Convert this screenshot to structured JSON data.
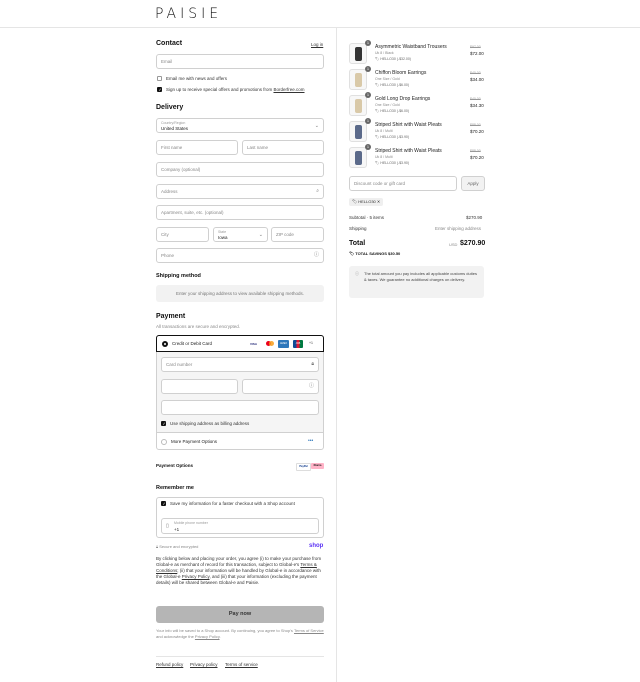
{
  "brand": "PAISIE",
  "contact": {
    "title": "Contact",
    "login_label": "Log in",
    "email_placeholder": "Email",
    "email_news_label": "Email me with news and offers",
    "sms_label_prefix": "Sign up to receive special offers and promotions from ",
    "sms_label_link": "Borderfree.com"
  },
  "delivery": {
    "title": "Delivery",
    "country_label": "Country/Region",
    "country_value": "United States",
    "first_name": "First name",
    "last_name": "Last name",
    "company": "Company (optional)",
    "address": "Address",
    "apartment": "Apartment, suite, etc. (optional)",
    "city": "City",
    "state_label": "State",
    "state_value": "Iowa",
    "zip": "ZIP code",
    "phone": "Phone"
  },
  "shipping": {
    "title": "Shipping method",
    "message": "Enter your shipping address to view available shipping methods."
  },
  "payment": {
    "title": "Payment",
    "subtitle": "All transactions are secure and encrypted.",
    "card_option": "Credit or Debit Card",
    "card_brands": [
      "VISA",
      "MC",
      "AMEX",
      "JCB",
      "+1"
    ],
    "card_number": "Card number",
    "billing_label": "Use shipping address as billing address",
    "more_options": "More Payment Options",
    "options_label": "Payment Options",
    "wallets": [
      "PayPal",
      "Klarna"
    ]
  },
  "remember": {
    "title": "Remember me",
    "save_label": "Save my information for a faster checkout with a Shop account",
    "mobile_label": "Mobile phone number",
    "mobile_value": "+1",
    "secure_label": "Secure and encrypted",
    "shop_label": "shop"
  },
  "legal": {
    "p1": "By clicking below and placing your order, you agree (i) to make your purchase from Global-e as merchant of record for this transaction, subject to Global-e's",
    "terms": "Terms & Conditions",
    "p2": "; (ii) that your information will be handled by Global-e in accordance with the Global-e",
    "privacy": "Privacy Policy",
    "p3": ", and (iii) that your information (excluding the payment details) will be shared between Global-e and Paisie."
  },
  "pay_now": "Pay now",
  "shop_note": {
    "p1": "Your info will be saved to a Shop account. By continuing, you agree to Shop's",
    "tos": "Terms of Service",
    "p2": " and acknowledge the ",
    "privacy": "Privacy Policy",
    "p3": "."
  },
  "footer_links": [
    "Refund policy",
    "Privacy policy",
    "Terms of service"
  ],
  "cart": {
    "items": [
      {
        "qty": "1",
        "name": "Asymmetric Waistband Trousers",
        "variant": "Uk 8 / Black",
        "discount": "HELLO30 (-$32.00)",
        "old_price": "$97.00",
        "price": "$72.00"
      },
      {
        "qty": "1",
        "name": "Chiffon Bloom Earrings",
        "variant": "One Size / Gold",
        "discount": "HELLO30 (-$6.00)",
        "old_price": "$40.00",
        "price": "$34.00"
      },
      {
        "qty": "1",
        "name": "Gold Long Drop Earrings",
        "variant": "One Size / Gold",
        "discount": "HELLO30 (-$6.00)",
        "old_price": "$40.00",
        "price": "$34.30"
      },
      {
        "qty": "1",
        "name": "Striped Shirt with Waist Pleats",
        "variant": "Uk 8 / Multi",
        "discount": "HELLO30 (-$3.90)",
        "old_price": "$88.00",
        "price": "$70.20"
      },
      {
        "qty": "1",
        "name": "Striped Shirt with Waist Pleats",
        "variant": "Uk 8 / Multi",
        "discount": "HELLO30 (-$3.90)",
        "old_price": "$88.00",
        "price": "$70.20"
      }
    ],
    "discount_placeholder": "Discount code or gift card",
    "apply_label": "Apply",
    "code_tag": "HELLO30",
    "subtotal_label": "Subtotal · 5 items",
    "subtotal_value": "$270.90",
    "shipping_label": "Shipping",
    "shipping_value": "Enter shipping address",
    "total_label": "Total",
    "currency": "USD",
    "total_value": "$270.90",
    "savings_label": "TOTAL SAVINGS",
    "savings_value": "$30.50",
    "duties_note": "The total amount you pay includes all applicable customs duties & taxes. We guarantee no additional charges on delivery."
  }
}
